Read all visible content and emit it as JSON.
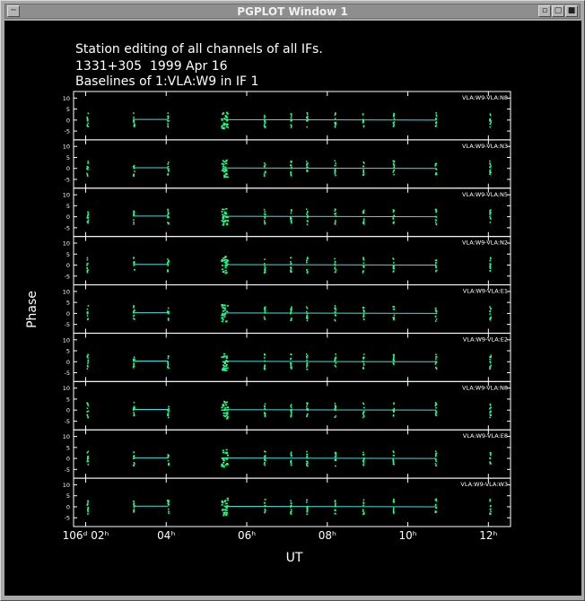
{
  "window": {
    "title": "PGPLOT Window 1",
    "menu_icon": "window-menu-icon",
    "minimize_icon": "minimize-icon",
    "maximize_icon": "maximize-icon",
    "close_icon": "close-icon"
  },
  "chart_data": {
    "type": "scatter",
    "title_lines": [
      "Station editing of all channels of all IFs.",
      "1331+305  1999 Apr 16",
      "Baselines of 1:VLA:W9 in IF 1"
    ],
    "xlabel": "UT",
    "ylabel": "Phase",
    "x_ticks": [
      {
        "label": "106ᵈ 02ʰ",
        "value": 2
      },
      {
        "label": "04ʰ",
        "value": 4
      },
      {
        "label": "06ʰ",
        "value": 6
      },
      {
        "label": "08ʰ",
        "value": 8
      },
      {
        "label": "10ʰ",
        "value": 10
      },
      {
        "label": "12ʰ",
        "value": 12
      }
    ],
    "xlim": [
      1.7,
      12.55
    ],
    "y_ticks": [
      10,
      5,
      0,
      -5
    ],
    "ylim": [
      -9,
      13
    ],
    "scan_times": [
      2.05,
      3.2,
      4.05,
      5.45,
      6.45,
      7.1,
      7.5,
      8.2,
      8.9,
      9.65,
      10.7,
      12.05
    ],
    "point_color": "#22ff88",
    "line_color": "#44dddd",
    "axis_color": "#ffffff",
    "panels": [
      {
        "label": "VLA:W9-VLA:N8"
      },
      {
        "label": "VLA:W9-VLA:N3"
      },
      {
        "label": "VLA:W9-VLA:N5"
      },
      {
        "label": "VLA:W9-VLA:N2"
      },
      {
        "label": "VLA:W9-VLA:E1"
      },
      {
        "label": "VLA:W9-VLA:E2"
      },
      {
        "label": "VLA:W9-VLA:N8"
      },
      {
        "label": "VLA:W9-VLA:E8"
      },
      {
        "label": "VLA:W9-VLA:W3"
      }
    ]
  }
}
